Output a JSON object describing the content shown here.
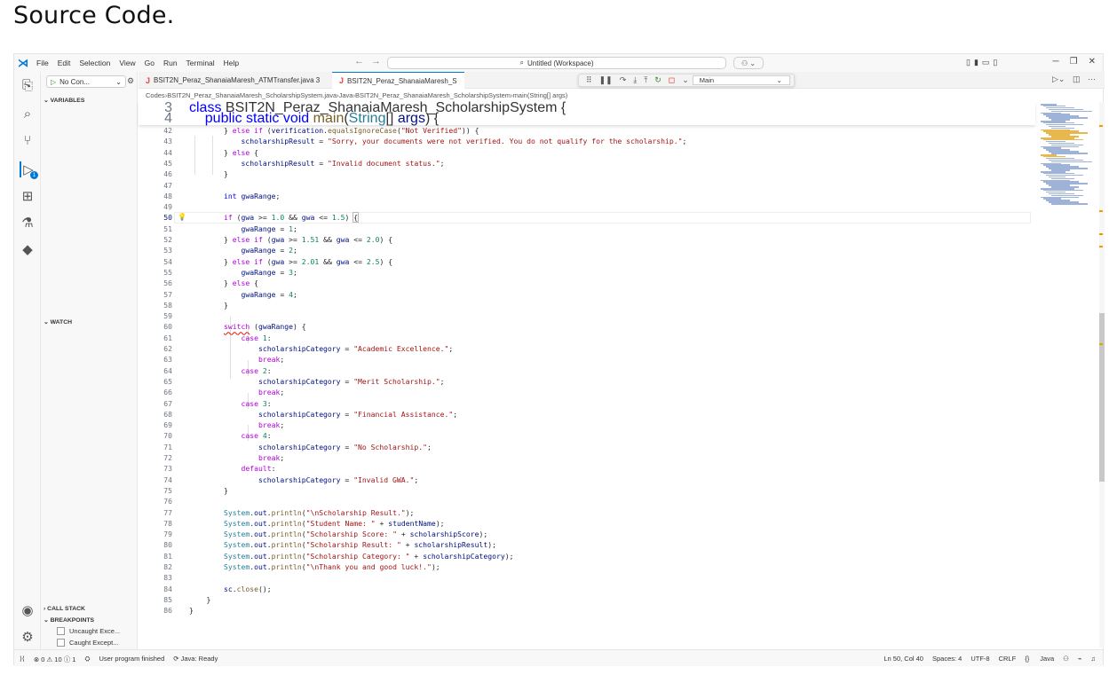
{
  "page": {
    "heading": "Source Code."
  },
  "titlebar": {
    "menu": [
      "File",
      "Edit",
      "Selection",
      "View",
      "Go",
      "Run",
      "Terminal",
      "Help"
    ],
    "command_center": "Untitled (Workspace)"
  },
  "sidebar": {
    "run_config": "No Con...",
    "sections": {
      "variables": "VARIABLES",
      "watch": "WATCH",
      "call_stack": "CALL STACK",
      "breakpoints": "BREAKPOINTS"
    },
    "breakpoints": [
      "Uncaught Exce...",
      "Caught Except..."
    ]
  },
  "tabs": [
    {
      "label": "BSIT2N_Peraz_ShanaiaMaresh_ATMTransfer.java 3",
      "active": false
    },
    {
      "label": "BSIT2N_Peraz_ShanaiaMaresh_S",
      "active": true
    }
  ],
  "debug_toolbar": {
    "target": "Main"
  },
  "breadcrumb": [
    "Codes",
    "BSIT2N_Peraz_ShanaiaMaresh_ScholarshipSystem.java",
    "Java",
    "BSIT2N_Peraz_ShanaiaMaresh_ScholarshipSystem",
    "main(String[] args)"
  ],
  "editor": {
    "current_line": 50,
    "sticky": [
      {
        "n": 3,
        "text": "class BSIT2N_Peraz_ShanaiaMaresh_ScholarshipSystem {"
      },
      {
        "n": 4,
        "text": "    public static void main(String[] args) {"
      }
    ],
    "lines": [
      {
        "n": 42,
        "text": "        } else if (verification.equalsIgnoreCase(\"Not Verified\")) {"
      },
      {
        "n": 43,
        "text": "            scholarshipResult = \"Sorry, your documents were not verified. You do not qualify for the scholarship.\";"
      },
      {
        "n": 44,
        "text": "        } else {"
      },
      {
        "n": 45,
        "text": "            scholarshipResult = \"Invalid document status.\";"
      },
      {
        "n": 46,
        "text": "        }"
      },
      {
        "n": 47,
        "text": ""
      },
      {
        "n": 48,
        "text": "        int gwaRange;"
      },
      {
        "n": 49,
        "text": ""
      },
      {
        "n": 50,
        "text": "        if (gwa >= 1.0 && gwa <= 1.5) {"
      },
      {
        "n": 51,
        "text": "            gwaRange = 1;"
      },
      {
        "n": 52,
        "text": "        } else if (gwa >= 1.51 && gwa <= 2.0) {"
      },
      {
        "n": 53,
        "text": "            gwaRange = 2;"
      },
      {
        "n": 54,
        "text": "        } else if (gwa >= 2.01 && gwa <= 2.5) {"
      },
      {
        "n": 55,
        "text": "            gwaRange = 3;"
      },
      {
        "n": 56,
        "text": "        } else {"
      },
      {
        "n": 57,
        "text": "            gwaRange = 4;"
      },
      {
        "n": 58,
        "text": "        }"
      },
      {
        "n": 59,
        "text": ""
      },
      {
        "n": 60,
        "text": "        switch (gwaRange) {"
      },
      {
        "n": 61,
        "text": "            case 1:"
      },
      {
        "n": 62,
        "text": "                scholarshipCategory = \"Academic Excellence.\";"
      },
      {
        "n": 63,
        "text": "                break;"
      },
      {
        "n": 64,
        "text": "            case 2:"
      },
      {
        "n": 65,
        "text": "                scholarshipCategory = \"Merit Scholarship.\";"
      },
      {
        "n": 66,
        "text": "                break;"
      },
      {
        "n": 67,
        "text": "            case 3:"
      },
      {
        "n": 68,
        "text": "                scholarshipCategory = \"Financial Assistance.\";"
      },
      {
        "n": 69,
        "text": "                break;"
      },
      {
        "n": 70,
        "text": "            case 4:"
      },
      {
        "n": 71,
        "text": "                scholarshipCategory = \"No Scholarship.\";"
      },
      {
        "n": 72,
        "text": "                break;"
      },
      {
        "n": 73,
        "text": "            default:"
      },
      {
        "n": 74,
        "text": "                scholarshipCategory = \"Invalid GWA.\";"
      },
      {
        "n": 75,
        "text": "        }"
      },
      {
        "n": 76,
        "text": ""
      },
      {
        "n": 77,
        "text": "        System.out.println(\"\\nScholarship Result.\");"
      },
      {
        "n": 78,
        "text": "        System.out.println(\"Student Name: \" + studentName);"
      },
      {
        "n": 79,
        "text": "        System.out.println(\"Scholarship Score: \" + scholarshipScore);"
      },
      {
        "n": 80,
        "text": "        System.out.println(\"Scholarship Result: \" + scholarshipResult);"
      },
      {
        "n": 81,
        "text": "        System.out.println(\"Scholarship Category: \" + scholarshipCategory);"
      },
      {
        "n": 82,
        "text": "        System.out.println(\"\\nThank you and good luck!.\");"
      },
      {
        "n": 83,
        "text": ""
      },
      {
        "n": 84,
        "text": "        sc.close();"
      },
      {
        "n": 85,
        "text": "    }"
      },
      {
        "n": 86,
        "text": "}"
      }
    ]
  },
  "statusbar": {
    "problems": "⊗ 0 ⚠ 10 ⓘ 1",
    "message": "User program finished",
    "java": "Java: Ready",
    "position": "Ln 50, Col 40",
    "spaces": "Spaces: 4",
    "encoding": "UTF-8",
    "eol": "CRLF",
    "language": "Java"
  },
  "colors": {
    "accent": "#0078d4",
    "keyword": "#0000ff",
    "control": "#af00db",
    "string": "#a31515",
    "number": "#098658",
    "variable": "#001080",
    "type": "#267f99"
  }
}
